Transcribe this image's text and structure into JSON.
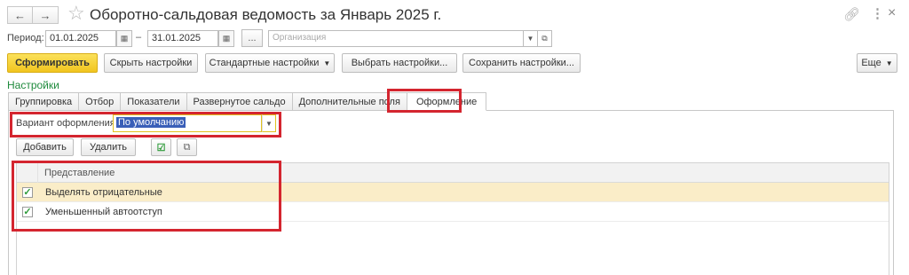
{
  "title": "Оборотно-сальдовая ведомость за Январь 2025 г.",
  "icons": {
    "back": "arrow-left-icon",
    "forward": "arrow-right-icon",
    "favorite": "star-icon",
    "link": "link-icon",
    "more": "more-vertical-icon",
    "close": "close-icon"
  },
  "period": {
    "label": "Период:",
    "from": "01.01.2025",
    "separator": "–",
    "to": "31.01.2025",
    "dots": "...",
    "organization_placeholder": "Организация"
  },
  "toolbar": {
    "generate": "Сформировать",
    "hide_settings": "Скрыть настройки",
    "standard_settings": "Стандартные настройки",
    "choose_settings": "Выбрать настройки...",
    "save_settings": "Сохранить настройки...",
    "more": "Еще"
  },
  "settings": {
    "label": "Настройки",
    "tabs": [
      {
        "label": "Группировка"
      },
      {
        "label": "Отбор"
      },
      {
        "label": "Показатели"
      },
      {
        "label": "Развернутое сальдо"
      },
      {
        "label": "Дополнительные поля"
      },
      {
        "label": "Оформление"
      }
    ],
    "active_tab": "Оформление"
  },
  "formatting": {
    "variant_label": "Вариант оформления:",
    "variant_value": "По умолчанию",
    "add": "Добавить",
    "delete": "Удалить"
  },
  "table": {
    "column": "Представление",
    "rows": [
      {
        "label": "Выделять отрицательные",
        "checked": true
      },
      {
        "label": "Уменьшенный автоотступ",
        "checked": true
      }
    ]
  },
  "colors": {
    "primary_button": "#f1c51f",
    "settings_label": "#1e8a3c",
    "annotation_frame": "#d4252f",
    "selected_row": "#faedc8"
  }
}
